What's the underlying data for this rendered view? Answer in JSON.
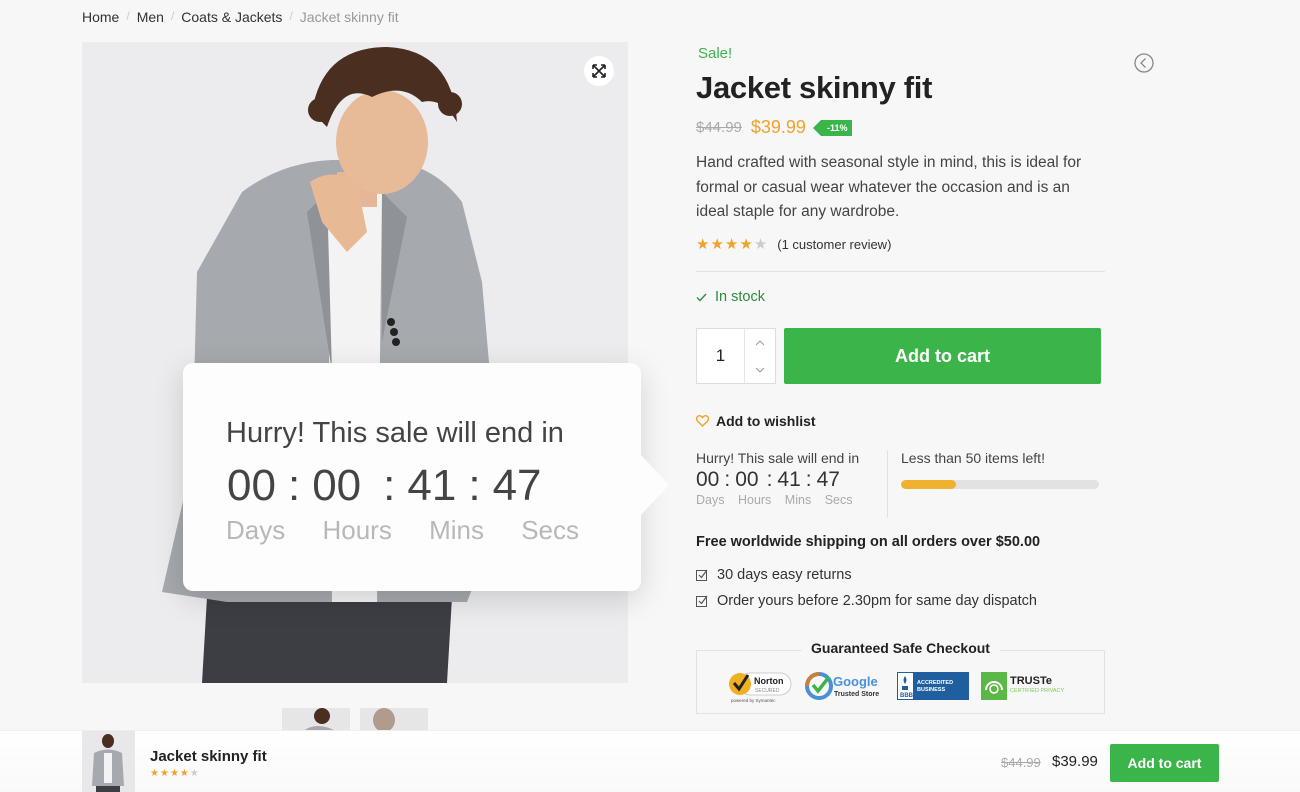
{
  "breadcrumb": {
    "items": [
      "Home",
      "Men",
      "Coats & Jackets"
    ],
    "separator": "/",
    "current": "Jacket skinny fit"
  },
  "gallery": {
    "image_alt": "Man in grey jacket",
    "zoom_icon": "expand-icon",
    "thumbnail_count": 2
  },
  "popup": {
    "title": "Hurry! This sale will end in",
    "days": "00",
    "hours": "00",
    "mins": "41",
    "secs": "47",
    "sep": ":",
    "labels": {
      "days": "Days",
      "hours": "Hours",
      "mins": "Mins",
      "secs": "Secs"
    }
  },
  "product": {
    "sale_label": "Sale!",
    "title": "Jacket skinny fit",
    "old_price": "$44.99",
    "new_price": "$39.99",
    "discount": "-11%",
    "description": "Hand crafted with seasonal style in mind, this is ideal for formal or casual wear whatever the occasion and is an ideal staple for any wardrobe.",
    "rating": 4,
    "rating_max": 5,
    "review_text": "(1 customer review)",
    "stock_status": "In stock",
    "quantity": "1",
    "add_to_cart": "Add to cart",
    "wishlist": "Add to wishlist"
  },
  "countdown": {
    "title": "Hurry! This sale will end in",
    "display": "00 : 00 : 41 : 47",
    "labels": "Days    Hours    Mins    Secs"
  },
  "stock_meter": {
    "text": "Less than 50 items left!",
    "fill_percent": 28
  },
  "shipping": {
    "headline": "Free worldwide shipping on all orders over $50.00",
    "perks": [
      "30 days easy returns",
      "Order yours before 2.30pm for same day dispatch"
    ]
  },
  "safe_checkout": {
    "title": "Guaranteed Safe Checkout",
    "badges": {
      "norton": {
        "name": "Norton",
        "sub": "SECURED",
        "powered": "powered by Symantec"
      },
      "google": {
        "name": "Google",
        "sub": "Trusted Store"
      },
      "bbb": {
        "name": "BBB",
        "line1": "ACCREDITED",
        "line2": "BUSINESS"
      },
      "truste": {
        "name": "TRUSTe",
        "sub": "CERTIFIED PRIVACY"
      }
    }
  },
  "sticky_bar": {
    "title": "Jacket skinny fit",
    "rating": 4,
    "old_price": "$44.99",
    "new_price": "$39.99",
    "button": "Add to cart"
  },
  "colors": {
    "accent_green": "#3bb54a",
    "price_orange": "#f0a22a",
    "stock_green": "#2e8b3e"
  }
}
